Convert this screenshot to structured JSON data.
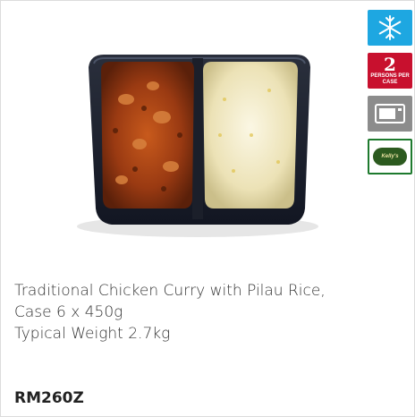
{
  "product": {
    "description_lines": [
      "Traditional Chicken Curry with Pilau Rice,",
      "Case 6 x 450g",
      "Typical Weight 2.7kg"
    ],
    "code": "RM260Z",
    "image_alt": "chicken-curry-with-pilau-rice-tray"
  },
  "badges": [
    {
      "name": "frozen-icon",
      "glyph": "❄",
      "color": "#1ea7e1"
    },
    {
      "name": "portions-icon",
      "number": "2",
      "text": "PERSONS PER CASE",
      "color": "#c8102e"
    },
    {
      "name": "microwave-icon",
      "color": "#8c8c8c"
    },
    {
      "name": "brand-logo-icon",
      "text": "Kelly's",
      "color": "#1e7a2e"
    }
  ]
}
